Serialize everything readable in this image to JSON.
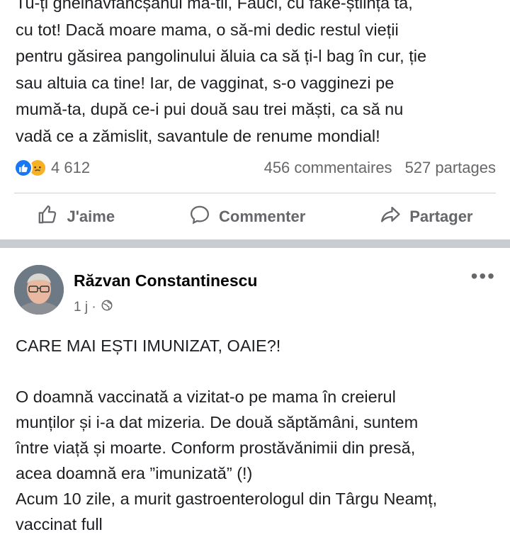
{
  "post1": {
    "lines": [
      "Tu-ți gheinăvfancșanul mă-tii, Fauci, cu fake-știința ta,",
      "cu tot! Dacă moare mama, o să-mi dedic restul vieții",
      "pentru găsirea pangolinului ăluia ca să ți-l bag în cur, ție",
      "sau altuia ca tine! Iar, de vagginat, s-o vagginezi pe",
      "mumă-ta, după ce-i pui două sau trei măști, ca să nu",
      "vadă ce a zămislit, savantule de renume mondial!"
    ],
    "reaction_count": "4 612",
    "comments": "456 commentaires",
    "shares": "527 partages",
    "actions": {
      "like": "J'aime",
      "comment": "Commenter",
      "share": "Partager"
    },
    "icons": {
      "like": "thumbs-up-icon",
      "comment": "speech-bubble-icon",
      "share": "share-arrow-icon"
    }
  },
  "post2": {
    "author": "Răzvan Constantinescu",
    "time": "1 j ·",
    "heading": "CARE MAI EȘTI IMUNIZAT, OAIE?!",
    "paragraph1": [
      "O doamnă vaccinată a vizitat-o pe mama în creierul",
      "munților și i-a dat mizeria. De două săptămâni, suntem",
      "între viață și moarte. Conform prostăvănimii din presă,",
      "acea doamnă era ”imunizată” (!)",
      "Acum 10 zile, a murit gastroenterologul din Târgu Neamț,",
      "vaccinat full"
    ]
  },
  "colors": {
    "like_blue": "#1877f2",
    "sad_yellow": "#f7b125",
    "muted": "#65676b",
    "separator": "#c9ccd1"
  }
}
